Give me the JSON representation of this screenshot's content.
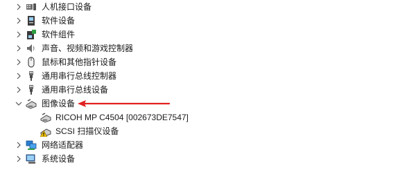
{
  "tree": {
    "items": [
      {
        "label": "人机接口设备",
        "icon": "hid-icon",
        "expanded": false
      },
      {
        "label": "软件设备",
        "icon": "software-device-icon",
        "expanded": false
      },
      {
        "label": "软件组件",
        "icon": "software-component-icon",
        "expanded": false
      },
      {
        "label": "声音、视频和游戏控制器",
        "icon": "speaker-icon",
        "expanded": false
      },
      {
        "label": "鼠标和其他指针设备",
        "icon": "mouse-icon",
        "expanded": false
      },
      {
        "label": "通用串行总线控制器",
        "icon": "usb-icon",
        "expanded": false
      },
      {
        "label": "通用串行总线设备",
        "icon": "usb-icon",
        "expanded": false
      },
      {
        "label": "图像设备",
        "icon": "imaging-device-icon",
        "expanded": true,
        "children": [
          {
            "label": "RICOH MP C4504 [002673DE7547]",
            "icon": "scanner-icon"
          },
          {
            "label": "SCSI 扫描仪设备",
            "icon": "scanner-warning-icon"
          }
        ]
      },
      {
        "label": "网络适配器",
        "icon": "network-adapter-icon",
        "expanded": false
      },
      {
        "label": "系统设备",
        "icon": "system-device-icon",
        "expanded": false
      }
    ]
  },
  "colors": {
    "annotation_arrow": "#e0201f",
    "usb_icon": "#5a5a5a",
    "network_icon": "#2a7fd4",
    "warning": "#f2c200"
  }
}
